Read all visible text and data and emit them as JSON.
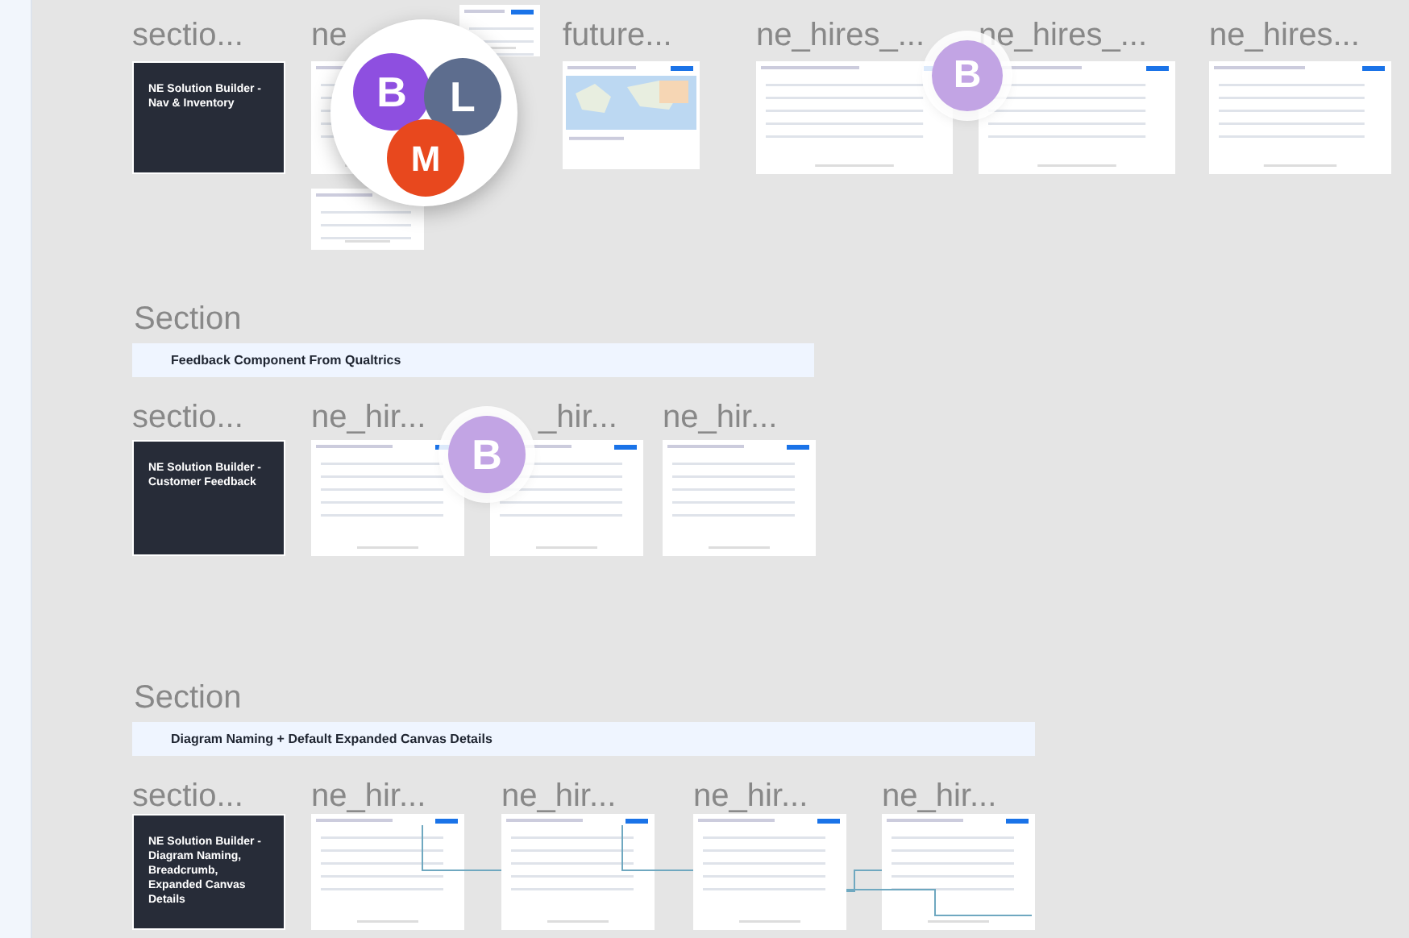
{
  "sections": [
    {
      "frames": [
        {
          "label": "sectio...",
          "kind": "cover",
          "text": "NE Solution Builder - Nav & Inventory"
        },
        {
          "label": "ne",
          "kind": "screen"
        },
        {
          "label": "future...",
          "kind": "map"
        },
        {
          "label": "ne_hires_...",
          "kind": "screen"
        },
        {
          "label": "ne_hires_...",
          "kind": "screen"
        },
        {
          "label": "ne_hires...",
          "kind": "screen"
        }
      ]
    },
    {
      "title": "Section",
      "banner": "Feedback Component From Qualtrics",
      "frames": [
        {
          "label": "sectio...",
          "kind": "cover",
          "text": "NE Solution Builder - Customer Feedback"
        },
        {
          "label": "ne_hir...",
          "kind": "screen"
        },
        {
          "label": "_hir...",
          "kind": "screen"
        },
        {
          "label": "ne_hir...",
          "kind": "screen"
        }
      ]
    },
    {
      "title": "Section",
      "banner": "Diagram Naming + Default Expanded Canvas Details",
      "frames": [
        {
          "label": "sectio...",
          "kind": "cover",
          "text": "NE Solution Builder - Diagram Naming, Breadcrumb, Expanded Canvas Details"
        },
        {
          "label": "ne_hir...",
          "kind": "screen"
        },
        {
          "label": "ne_hir...",
          "kind": "screen"
        },
        {
          "label": "ne_hir...",
          "kind": "screen"
        },
        {
          "label": "ne_hir...",
          "kind": "screen"
        }
      ]
    }
  ],
  "cursor_groups": [
    {
      "avatars": [
        {
          "letter": "B",
          "color": "#8e4fe0"
        },
        {
          "letter": "L",
          "color": "#5d6d8e"
        },
        {
          "letter": "M",
          "color": "#e8481e"
        }
      ]
    },
    {
      "avatars": [
        {
          "letter": "B",
          "color": "#c2a4e4"
        }
      ]
    },
    {
      "avatars": [
        {
          "letter": "B",
          "color": "#c2a4e4"
        }
      ]
    }
  ]
}
